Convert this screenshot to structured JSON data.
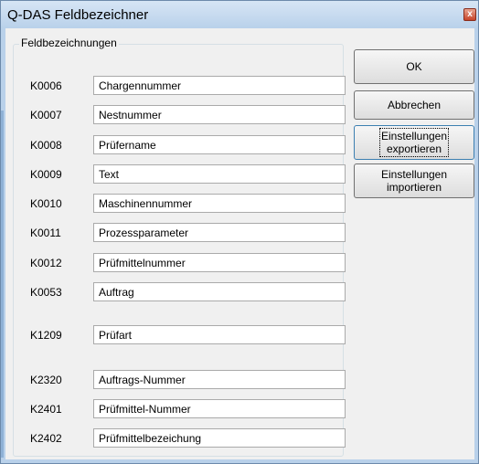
{
  "window": {
    "title": "Q-DAS Feldbezeichner",
    "close_glyph": "x"
  },
  "group": {
    "title": "Feldbezeichnungen"
  },
  "fields": [
    {
      "code": "K0006",
      "value": "Chargennummer"
    },
    {
      "code": "K0007",
      "value": "Nestnummer"
    },
    {
      "code": "K0008",
      "value": "Prüfername"
    },
    {
      "code": "K0009",
      "value": "Text"
    },
    {
      "code": "K0010",
      "value": "Maschinennummer"
    },
    {
      "code": "K0011",
      "value": "Prozessparameter"
    },
    {
      "code": "K0012",
      "value": "Prüfmittelnummer"
    },
    {
      "code": "K0053",
      "value": "Auftrag"
    },
    {
      "code": "K1209",
      "value": "Prüfart"
    },
    {
      "code": "K2320",
      "value": "Auftrags-Nummer"
    },
    {
      "code": "K2401",
      "value": "Prüfmittel-Nummer"
    },
    {
      "code": "K2402",
      "value": "Prüfmittelbezeichung"
    }
  ],
  "buttons": {
    "ok": "OK",
    "cancel": "Abbrechen",
    "export": "Einstellungen\nexportieren",
    "import": "Einstellungen\nimportieren"
  }
}
